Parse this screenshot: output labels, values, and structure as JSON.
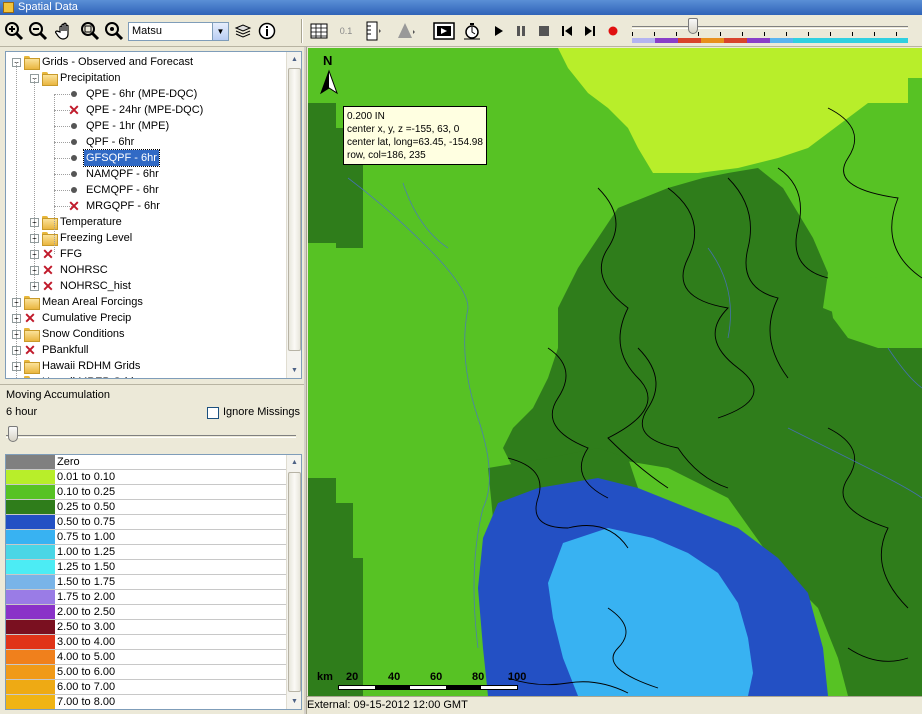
{
  "window": {
    "title": "Spatial Data"
  },
  "toolbar": {
    "region": "Matsu",
    "buttons": [
      "zoom-in-icon",
      "zoom-out-icon",
      "pan-hand-icon",
      "zoom-box-icon",
      "zoom-full-icon",
      "layers-icon",
      "info-icon",
      "table-icon",
      "values-icon",
      "gauge-icon",
      "warning-icon",
      "animation-icon",
      "time-step-icon",
      "play-icon",
      "pause-icon",
      "stop-icon",
      "step-back-icon",
      "step-forward-icon",
      "record-icon"
    ],
    "values_label": "0.1",
    "time_slider": {
      "position": 0.21,
      "colors": [
        "#b4b4f0",
        "#8a3fc8",
        "#d8442c",
        "#e8901c",
        "#d8442c",
        "#8a3fc8",
        "#5ab4f0",
        "#30d0e0",
        "#30d0e0",
        "#30d0e0",
        "#30d0e0",
        "#30d0e0"
      ]
    }
  },
  "tree": {
    "items": [
      {
        "label": "Grids - Observed and Forecast",
        "level": 0,
        "icon": "folder",
        "expanded": true
      },
      {
        "label": "Precipitation",
        "level": 1,
        "icon": "folder",
        "expanded": true
      },
      {
        "label": "QPE - 6hr (MPE-DQC)",
        "level": 2,
        "icon": "dot"
      },
      {
        "label": "QPE - 24hr (MPE-DQC)",
        "level": 2,
        "icon": "x"
      },
      {
        "label": "QPE - 1hr (MPE)",
        "level": 2,
        "icon": "dot"
      },
      {
        "label": "QPF - 6hr",
        "level": 2,
        "icon": "dot"
      },
      {
        "label": "GFSQPF - 6hr",
        "level": 2,
        "icon": "dot",
        "selected": true
      },
      {
        "label": "NAMQPF - 6hr",
        "level": 2,
        "icon": "dot"
      },
      {
        "label": "ECMQPF - 6hr",
        "level": 2,
        "icon": "dot"
      },
      {
        "label": "MRGQPF - 6hr",
        "level": 2,
        "icon": "x"
      },
      {
        "label": "Temperature",
        "level": 1,
        "icon": "folder",
        "expanded": false
      },
      {
        "label": "Freezing Level",
        "level": 1,
        "icon": "folder",
        "expanded": false
      },
      {
        "label": "FFG",
        "level": 1,
        "icon": "x",
        "expanded": false
      },
      {
        "label": "NOHRSC",
        "level": 1,
        "icon": "x",
        "expanded": false
      },
      {
        "label": "NOHRSC_hist",
        "level": 1,
        "icon": "x",
        "expanded": false
      },
      {
        "label": "Mean Areal Forcings",
        "level": 0,
        "icon": "folder",
        "expanded": false
      },
      {
        "label": "Cumulative Precip",
        "level": 0,
        "icon": "x",
        "expanded": false
      },
      {
        "label": "Snow Conditions",
        "level": 0,
        "icon": "folder",
        "expanded": false
      },
      {
        "label": "PBankfull",
        "level": 0,
        "icon": "x",
        "expanded": false
      },
      {
        "label": "Hawaii RDHM Grids",
        "level": 0,
        "icon": "folder",
        "expanded": false
      },
      {
        "label": "Hawaii MREP Grids",
        "level": 0,
        "icon": "folder",
        "expanded": false
      }
    ]
  },
  "accumulation": {
    "title": "Moving Accumulation",
    "value": "6 hour",
    "ignore_missing_label": "Ignore Missings",
    "ignore_missing_checked": false,
    "slider_level": 0
  },
  "legend": {
    "rows": [
      {
        "color": "#808080",
        "label": "Zero"
      },
      {
        "color": "#b8ee2a",
        "label": "0.01 to 0.10"
      },
      {
        "color": "#57c224",
        "label": "0.10 to 0.25"
      },
      {
        "color": "#2f7d1b",
        "label": "0.25 to 0.50"
      },
      {
        "color": "#2350c4",
        "label": "0.50 to 0.75"
      },
      {
        "color": "#38b2f2",
        "label": "0.75 to 1.00"
      },
      {
        "color": "#4ad6e6",
        "label": "1.00 to 1.25"
      },
      {
        "color": "#4cecf4",
        "label": "1.25 to 1.50"
      },
      {
        "color": "#79b4e8",
        "label": "1.50 to 1.75"
      },
      {
        "color": "#9a7ce6",
        "label": "1.75 to 2.00"
      },
      {
        "color": "#8a32c8",
        "label": "2.00 to 2.50"
      },
      {
        "color": "#7a1020",
        "label": "2.50 to 3.00"
      },
      {
        "color": "#e03418",
        "label": "3.00 to 4.00"
      },
      {
        "color": "#f0801c",
        "label": "4.00 to 5.00"
      },
      {
        "color": "#f09a18",
        "label": "5.00 to 6.00"
      },
      {
        "color": "#eeaa14",
        "label": "6.00 to 7.00"
      },
      {
        "color": "#f0b414",
        "label": "7.00 to 8.00"
      }
    ]
  },
  "map": {
    "north_label": "N",
    "tooltip": [
      "0.200 IN",
      "center x, y, z =-155, 63, 0",
      "center lat, long=63.45, -154.98",
      "row, col=186, 235"
    ],
    "scale": {
      "units": "km",
      "ticks": [
        "20",
        "40",
        "60",
        "80",
        "100"
      ]
    }
  },
  "status": {
    "text": "External: 09-15-2012 12:00 GMT"
  }
}
